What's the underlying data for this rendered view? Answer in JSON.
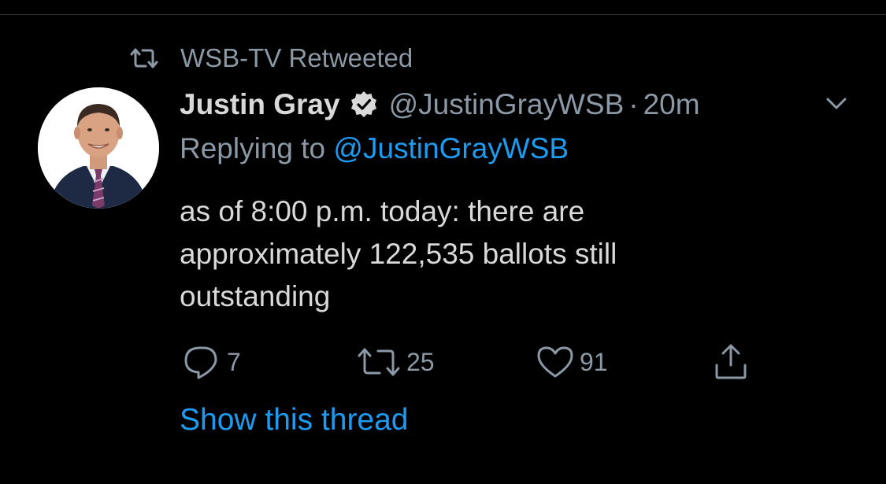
{
  "retweet_context": {
    "label": "WSB-TV Retweeted",
    "icon": "retweet-icon"
  },
  "tweet": {
    "author": {
      "display_name": "Justin Gray",
      "verified": true,
      "handle": "@JustinGrayWSB",
      "separator": "·",
      "timestamp": "20m",
      "avatar_icon": "profile-photo"
    },
    "reply": {
      "prefix": "Replying to",
      "mention": "@JustinGrayWSB"
    },
    "text_lines": [
      "as of 8:00 p.m. today: there are",
      "approximately 122,535 ballots still",
      "outstanding"
    ],
    "actions": {
      "reply_count": "7",
      "retweet_count": "25",
      "like_count": "91"
    },
    "show_thread_label": "Show this thread"
  },
  "colors": {
    "background": "#000000",
    "text_primary": "#d9d9d9",
    "text_secondary": "#8b98a5",
    "accent": "#1d9bf0"
  }
}
